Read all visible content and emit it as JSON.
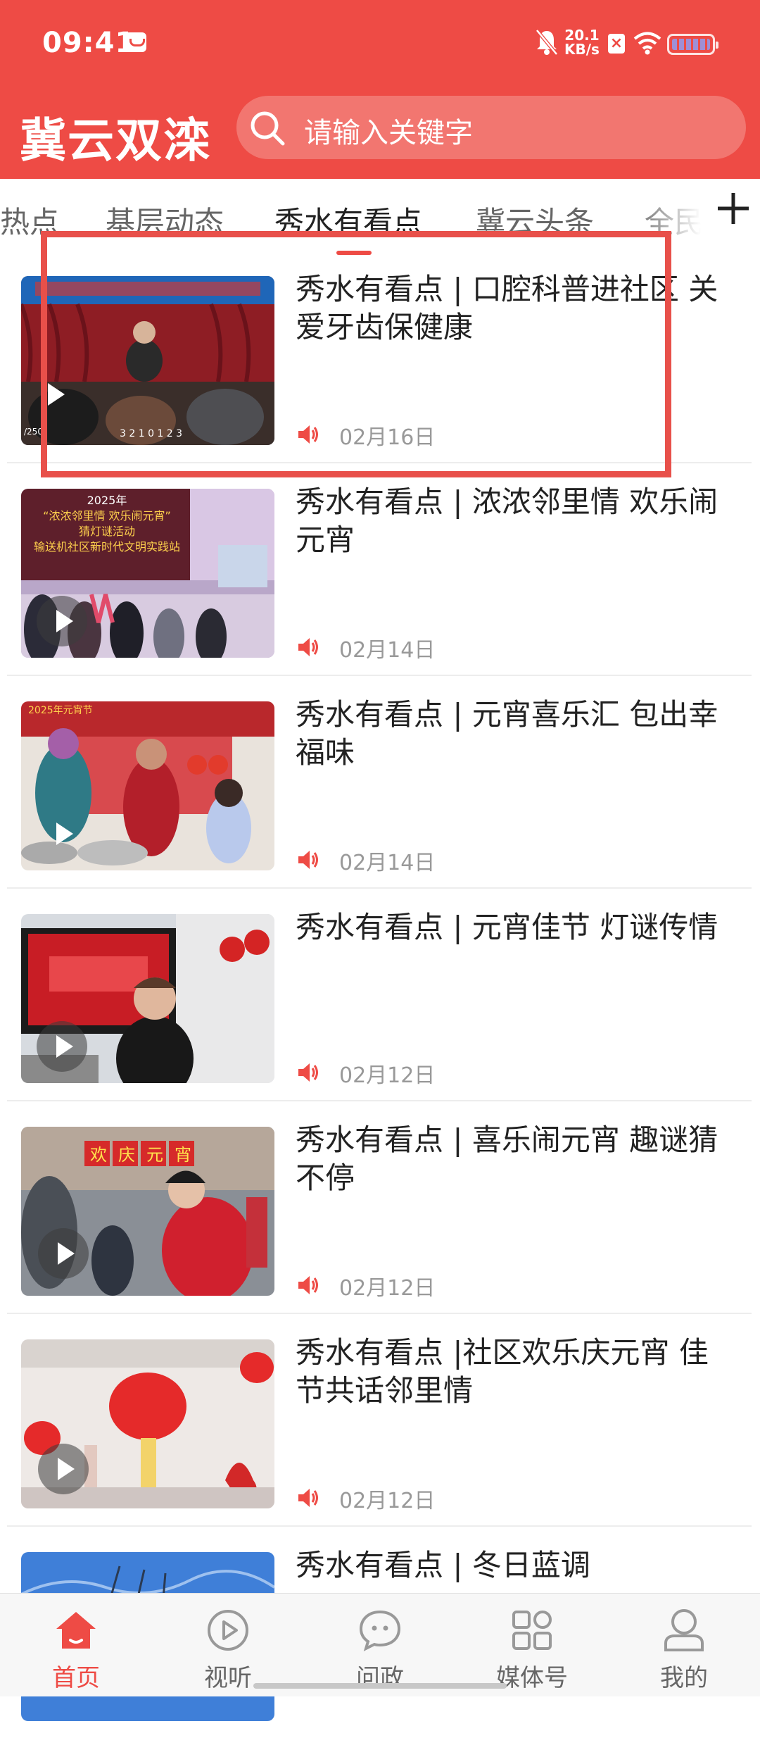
{
  "status_bar": {
    "time": "09:41",
    "net_speed_value": "20.1",
    "net_speed_unit": "KB/s",
    "icons": [
      "message-icon",
      "mute-icon",
      "sim-off-icon",
      "wifi-icon",
      "battery-icon"
    ]
  },
  "header": {
    "app_title": "冀云双滦",
    "search_placeholder": "请输入关键字"
  },
  "tabs": {
    "items": [
      "热点",
      "基层动态",
      "秀水有看点",
      "冀云头条",
      "全民"
    ],
    "active": "秀水有看点",
    "add_icon": "plus-icon"
  },
  "news": [
    {
      "title": "秀水有看点 | 口腔科普进社区 关爱牙齿保健康",
      "date": "02月16日",
      "thumb_caption": "3 2 1 0 1 2 3",
      "thumb_counter": "/250"
    },
    {
      "title": "秀水有看点 | 浓浓邻里情 欢乐闹元宵",
      "date": "02月14日",
      "thumb_banner": [
        "2025年",
        "“浓浓邻里情 欢乐闹元宵”",
        "猜灯谜活动",
        "输送机社区新时代文明实践站"
      ]
    },
    {
      "title": "秀水有看点 | 元宵喜乐汇 包出幸福味",
      "date": "02月14日",
      "thumb_banner": [
        "2025年",
        "元宵节"
      ]
    },
    {
      "title": "秀水有看点 | 元宵佳节 灯谜传情",
      "date": "02月12日"
    },
    {
      "title": "秀水有看点 | 喜乐闹元宵 趣谜猜不停",
      "date": "02月12日",
      "thumb_banner": [
        "欢",
        "庆",
        "元",
        "宵"
      ]
    },
    {
      "title": "秀水有看点 |社区欢乐庆元宵 佳节共话邻里情",
      "date": "02月12日"
    },
    {
      "title": "秀水有看点 | 冬日蓝调",
      "date": ""
    }
  ],
  "bottom_nav": [
    {
      "label": "首页",
      "icon": "home-icon",
      "active": true
    },
    {
      "label": "视听",
      "icon": "play-circle-icon",
      "active": false
    },
    {
      "label": "问政",
      "icon": "chat-icon",
      "active": false
    },
    {
      "label": "媒体号",
      "icon": "grid-icon",
      "active": false
    },
    {
      "label": "我的",
      "icon": "profile-icon",
      "active": false
    }
  ],
  "colors": {
    "brand": "#ee4b45",
    "title_text": "#222222",
    "date_text": "#999999",
    "highlight": "#e8504a"
  }
}
